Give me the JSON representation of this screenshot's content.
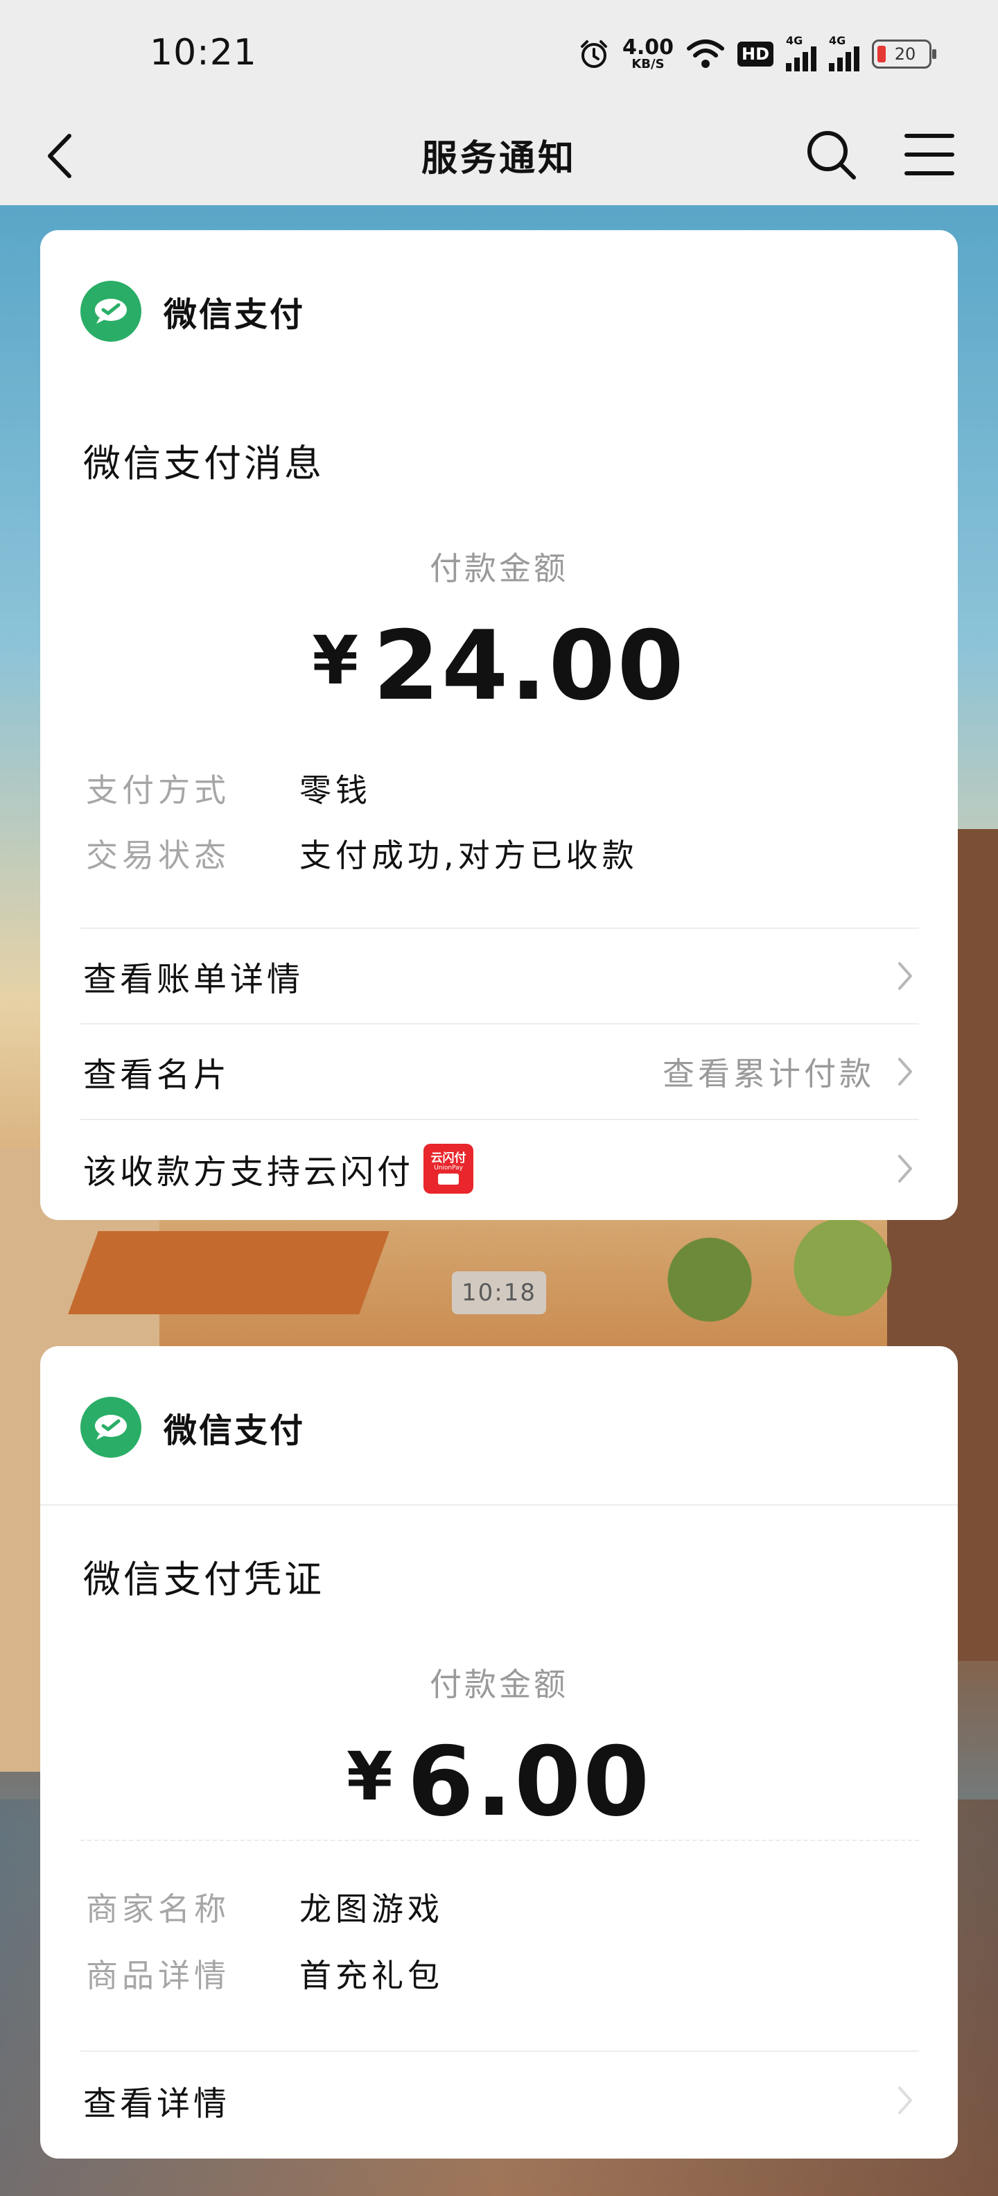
{
  "status": {
    "time": "10:21",
    "speed_value": "4.00",
    "speed_unit": "KB/S",
    "hd_label": "HD",
    "network_1": "4G",
    "network_2": "4G",
    "battery": "20",
    "icons": [
      "alarm-icon",
      "wifi-icon",
      "signal-icon",
      "battery-icon"
    ]
  },
  "nav": {
    "title": "服务通知",
    "icons": [
      "back-icon",
      "search-icon",
      "menu-icon"
    ]
  },
  "card1": {
    "brand": "微信支付",
    "title": "微信支付消息",
    "amount_label": "付款金额",
    "currency": "¥",
    "amount": "24.00",
    "details": [
      {
        "key": "支付方式",
        "value": "零钱"
      },
      {
        "key": "交易状态",
        "value": "支付成功,对方已收款"
      }
    ],
    "rows": [
      {
        "label": "查看账单详情",
        "extra": ""
      },
      {
        "label": "查看名片",
        "extra": "查看累计付款"
      },
      {
        "label": "该收款方支持云闪付",
        "extra": ""
      }
    ],
    "yunshan_logo_text": "云闪付",
    "yunshan_logo_sub": "UnionPay"
  },
  "timestamp": "10:18",
  "card2": {
    "brand": "微信支付",
    "title": "微信支付凭证",
    "amount_label": "付款金额",
    "currency": "¥",
    "amount": "6.00",
    "details": [
      {
        "key": "商家名称",
        "value": "龙图游戏"
      },
      {
        "key": "商品详情",
        "value": "首充礼包"
      }
    ],
    "rows": [
      {
        "label": "查看详情",
        "extra": ""
      }
    ]
  },
  "colors": {
    "wechat_green": "#2AAE67",
    "unionpay_red": "#E8262C",
    "background_gray": "#EDEDED"
  }
}
